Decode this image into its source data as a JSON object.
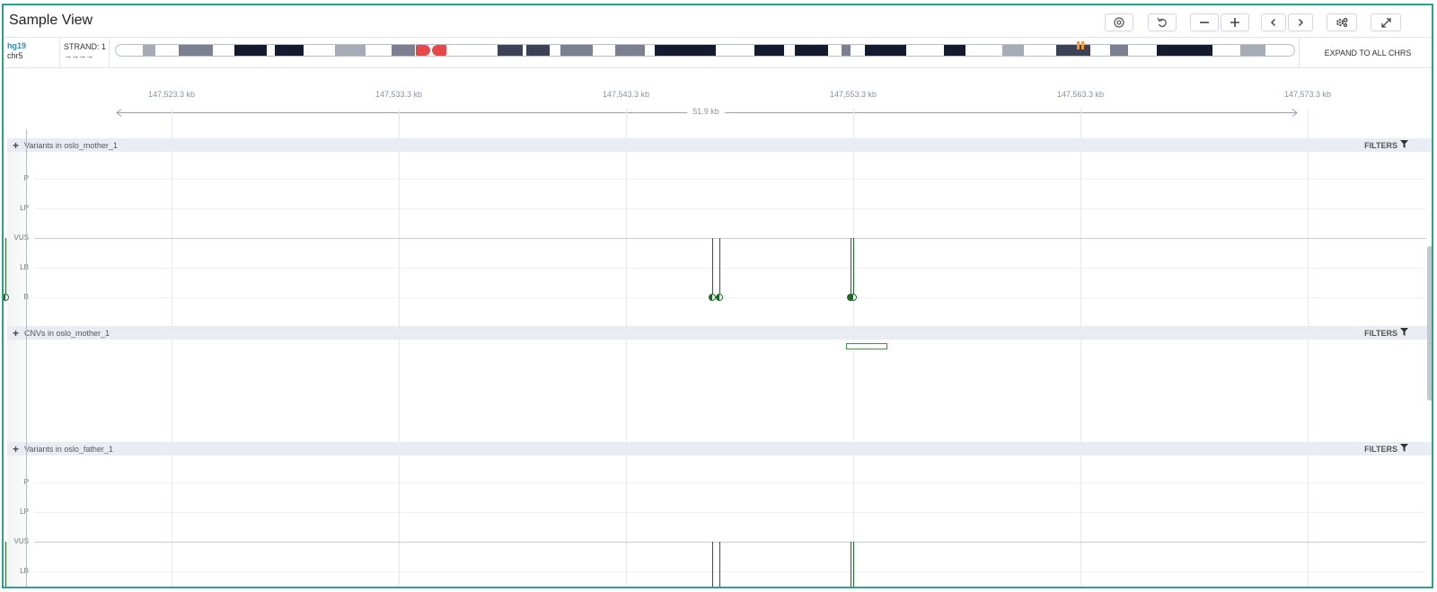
{
  "app": {
    "title": "Sample View"
  },
  "toolbar": {
    "buttons": [
      {
        "name": "locate-button",
        "icon": "target-icon"
      },
      {
        "name": "reset-button",
        "icon": "undo-icon"
      },
      {
        "name": "zoom-out-button",
        "icon": "minus-icon"
      },
      {
        "name": "zoom-in-button",
        "icon": "plus-icon"
      },
      {
        "name": "pan-left-button",
        "icon": "chevron-left-icon"
      },
      {
        "name": "pan-right-button",
        "icon": "chevron-right-icon"
      },
      {
        "name": "settings-button",
        "icon": "gear-icon"
      },
      {
        "name": "fullscreen-button",
        "icon": "expand-icon"
      }
    ]
  },
  "chromosome": {
    "genome": "hg19",
    "chr": "chr5",
    "strand_label": "STRAND: 1",
    "strand_arrows": "→→→→",
    "expand_label": "EXPAND TO ALL CHRS",
    "centromere_color": "#e8464a",
    "locus_marker_color": "#f59a2b"
  },
  "ruler": {
    "ticks": [
      "147,523.3 kb",
      "147,533.3 kb",
      "147,543.3 kb",
      "147,553.3 kb",
      "147,563.3 kb",
      "147,573.3 kb"
    ],
    "span": "51.9 kb"
  },
  "tracks": [
    {
      "title": "Variants in oslo_mother_1",
      "type": "variants",
      "filters_label": "FILTERS",
      "levels": [
        "P",
        "LP",
        "VUS",
        "LB",
        "B"
      ],
      "variants": [
        {
          "pos_kb": 147516.0,
          "level": "B"
        },
        {
          "pos_kb": 147547.1,
          "level": "B"
        },
        {
          "pos_kb": 147547.4,
          "level": "B"
        },
        {
          "pos_kb": 147553.2,
          "level": "B"
        },
        {
          "pos_kb": 147553.3,
          "level": "B"
        }
      ]
    },
    {
      "title": "CNVs in oslo_mother_1",
      "type": "cnv",
      "filters_label": "FILTERS",
      "cnvs": [
        {
          "start_kb": 147553.0,
          "end_kb": 147554.8
        }
      ]
    },
    {
      "title": "Variants in oslo_father_1",
      "type": "variants",
      "filters_label": "FILTERS",
      "levels": [
        "P",
        "LP",
        "VUS",
        "LB"
      ],
      "variants": [
        {
          "pos_kb": 147516.0,
          "level": "B"
        },
        {
          "pos_kb": 147547.1,
          "level": "B"
        },
        {
          "pos_kb": 147547.4,
          "level": "B"
        },
        {
          "pos_kb": 147553.2,
          "level": "B"
        },
        {
          "pos_kb": 147553.3,
          "level": "B"
        }
      ]
    }
  ],
  "colors": {
    "variant": "#1b6b26",
    "frame": "#2e9e8f",
    "track_header": "#e9edf3"
  }
}
